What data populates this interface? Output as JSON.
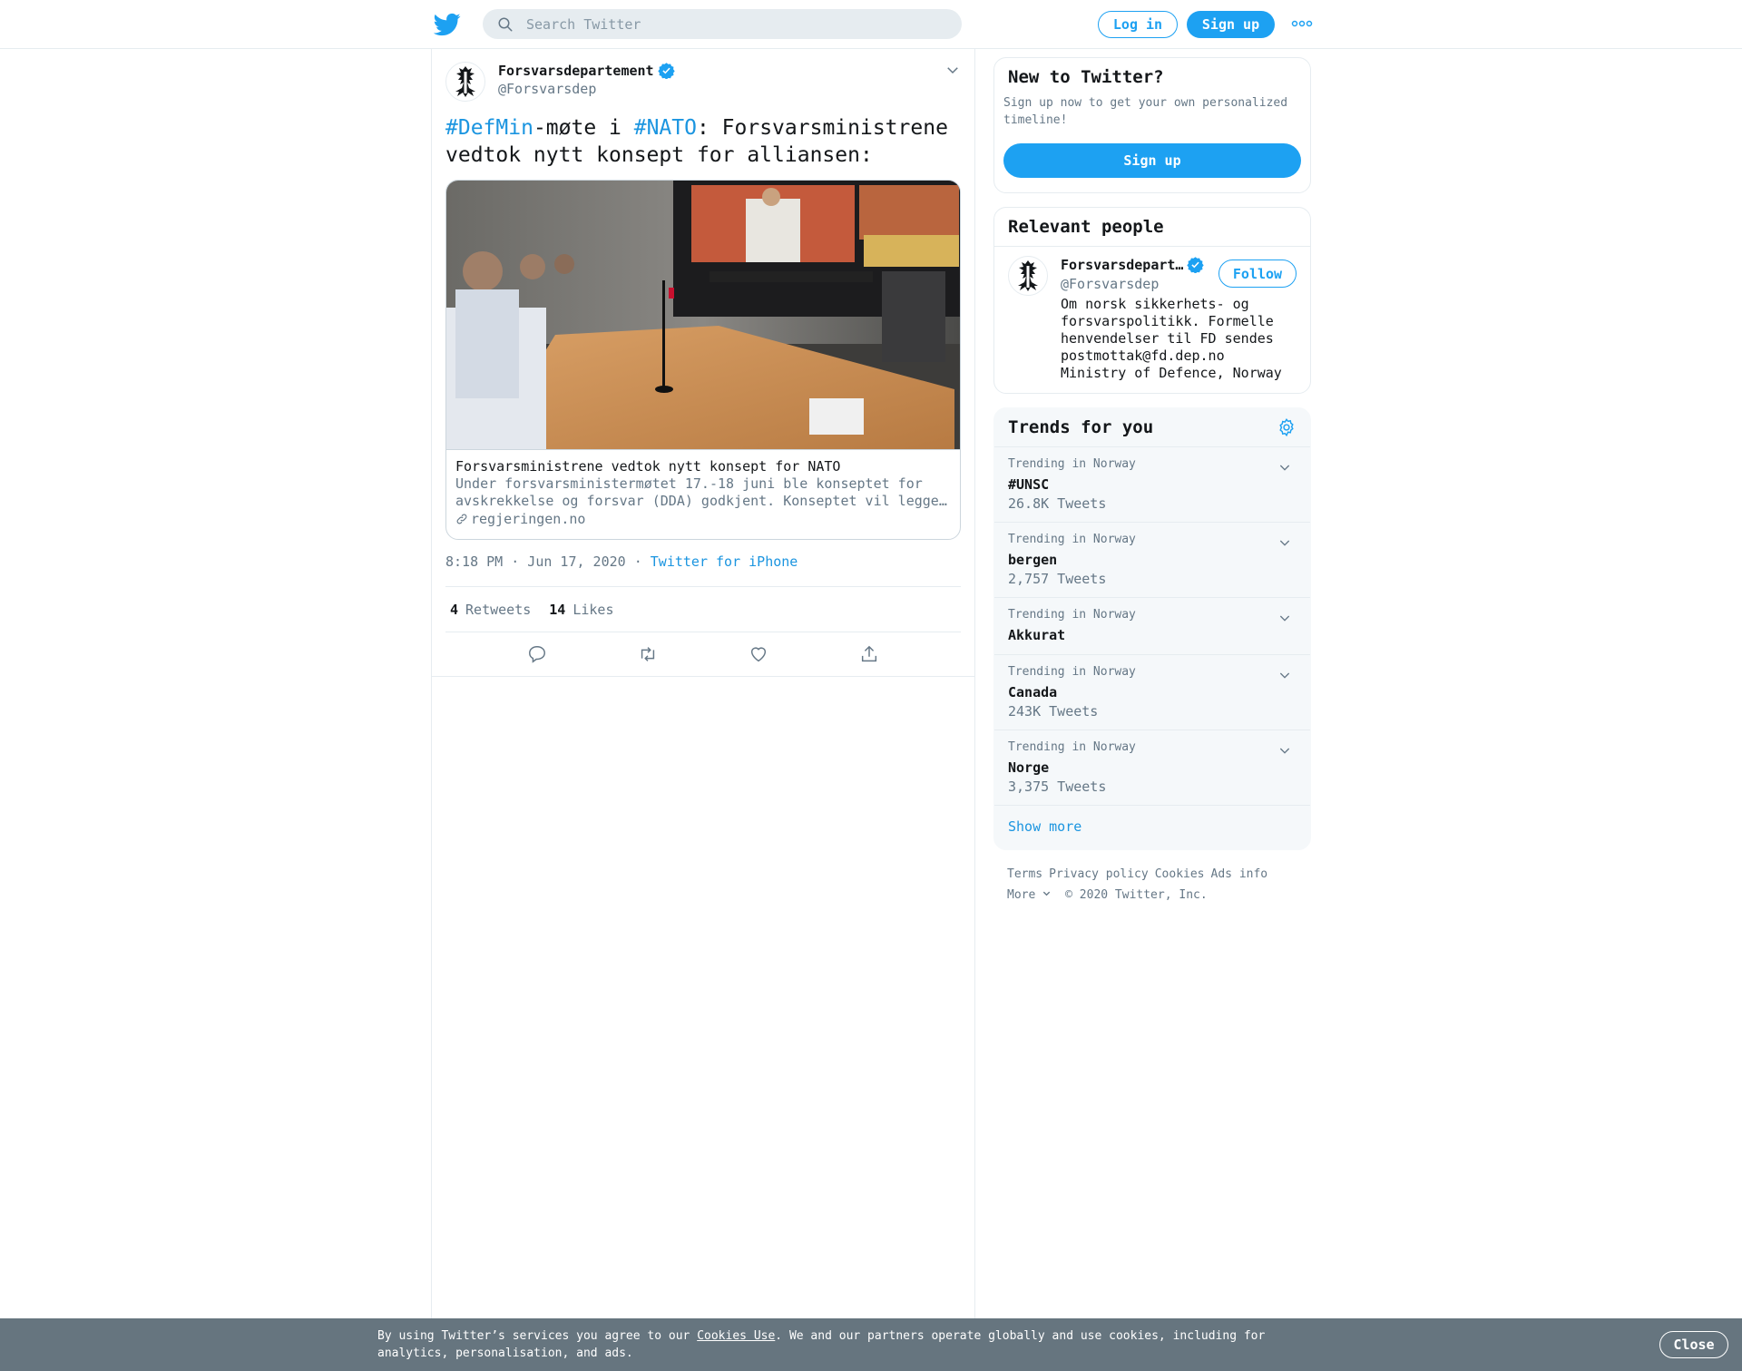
{
  "header": {
    "search_placeholder": "Search Twitter",
    "login_label": "Log in",
    "signup_label": "Sign up"
  },
  "tweet": {
    "author_name": "Forsvarsdepartement",
    "author_handle": "@Forsvarsdep",
    "text_parts": {
      "hashtag1": "#DefMin",
      "part1": "-møte i ",
      "hashtag2": "#NATO",
      "part2": ": Forsvarsministrene vedtok nytt konsept for alliansen:"
    },
    "card": {
      "title": "Forsvarsministrene vedtok nytt konsept for NATO",
      "description": "Under forsvarsministermøtet 17.-18 juni ble konseptet for avskrekkelse og forsvar (DDA) godkjent. Konseptet vil legge…",
      "domain": "regjeringen.no"
    },
    "time": "8:18 PM · Jun 17, 2020",
    "separator": " · ",
    "source": "Twitter for iPhone",
    "retweets_count": "4",
    "retweets_label": "Retweets",
    "likes_count": "14",
    "likes_label": "Likes"
  },
  "sidebar": {
    "new_to_twitter": {
      "title": "New to Twitter?",
      "description": "Sign up now to get your own personalized timeline!",
      "button": "Sign up"
    },
    "relevant_people": {
      "title": "Relevant people",
      "name": "Forsvarsdepart…",
      "handle": "@Forsvarsdep",
      "follow_label": "Follow",
      "bio_line1": "Om norsk sikkerhets- og forsvarspolitikk. Formelle henvendelser til FD sendes postmottak@fd.dep.no",
      "bio_line2": "Ministry of Defence, Norway"
    },
    "trends": {
      "title": "Trends for you",
      "items": [
        {
          "context": "Trending in Norway",
          "name": "#UNSC",
          "count": "26.8K Tweets"
        },
        {
          "context": "Trending in Norway",
          "name": "bergen",
          "count": "2,757 Tweets"
        },
        {
          "context": "Trending in Norway",
          "name": "Akkurat",
          "count": ""
        },
        {
          "context": "Trending in Norway",
          "name": "Canada",
          "count": "243K Tweets"
        },
        {
          "context": "Trending in Norway",
          "name": "Norge",
          "count": "3,375 Tweets"
        }
      ],
      "show_more": "Show more"
    },
    "footer": {
      "terms": "Terms",
      "privacy": "Privacy policy",
      "cookies": "Cookies",
      "ads": "Ads info",
      "more": "More",
      "copyright": "© 2020 Twitter, Inc."
    }
  },
  "cookie_bar": {
    "text_before": "By using Twitter’s services you agree to our ",
    "link": "Cookies Use",
    "text_after": ". We and our partners operate globally and use cookies, including for analytics, personalisation, and ads.",
    "close_label": "Close"
  },
  "colors": {
    "accent": "#1da1f2",
    "link": "#1b95e0",
    "muted": "#657786",
    "cookie_bg": "#66757f"
  },
  "icons": {
    "logo": "twitter-bird-icon",
    "search": "search-icon",
    "more": "more-dots-icon",
    "verified": "verified-badge-icon",
    "caret": "chevron-down-icon",
    "link": "link-icon",
    "reply": "reply-icon",
    "retweet": "retweet-icon",
    "like": "heart-icon",
    "share": "share-icon",
    "settings": "gear-icon"
  }
}
